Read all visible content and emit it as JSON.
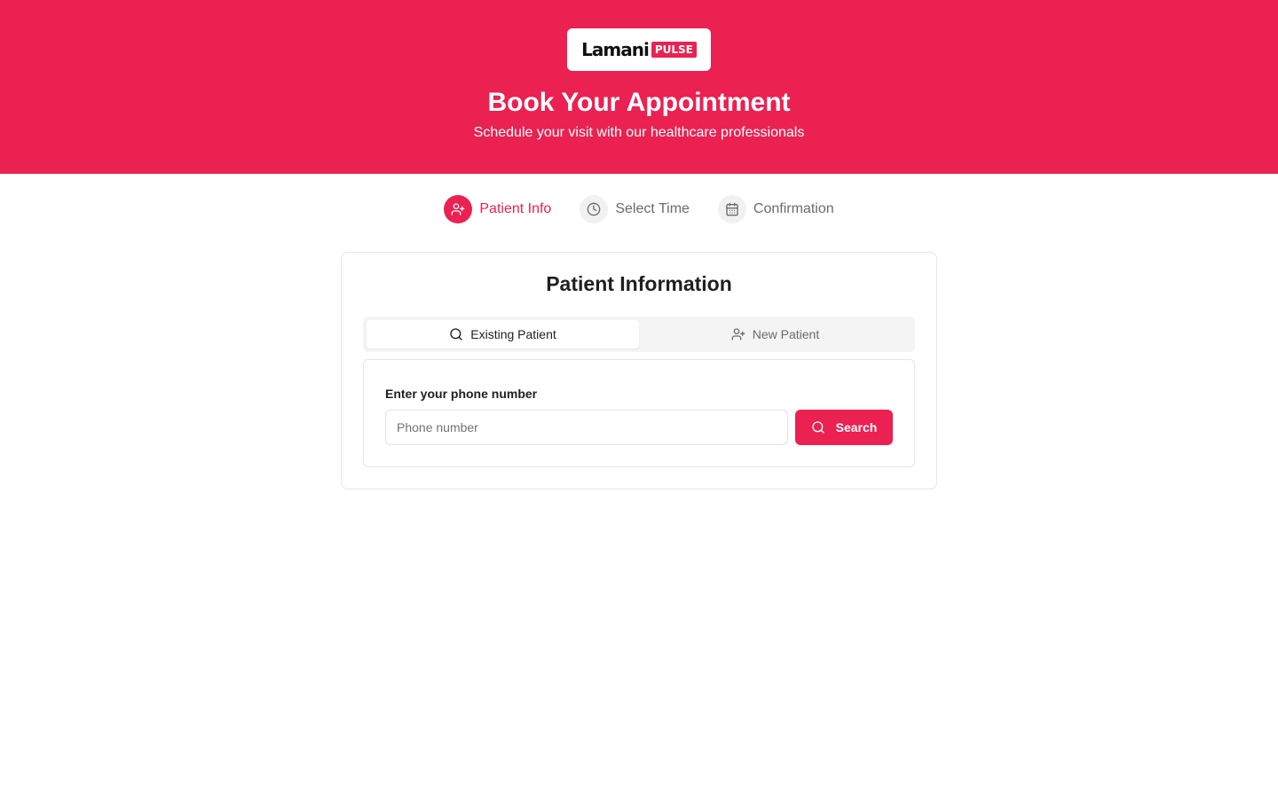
{
  "brand": {
    "logo_word": "Lamani",
    "logo_badge": "PULSE",
    "accent_color": "#eb2151"
  },
  "hero": {
    "title": "Book Your Appointment",
    "subtitle": "Schedule your visit with our healthcare professionals"
  },
  "steps": [
    {
      "label": "Patient Info",
      "icon": "user-plus-icon",
      "active": true
    },
    {
      "label": "Select Time",
      "icon": "clock-icon",
      "active": false
    },
    {
      "label": "Confirmation",
      "icon": "calendar-icon",
      "active": false
    }
  ],
  "card": {
    "title": "Patient Information",
    "tabs": [
      {
        "label": "Existing Patient",
        "icon": "search-icon",
        "active": true
      },
      {
        "label": "New Patient",
        "icon": "user-plus-icon",
        "active": false
      }
    ],
    "form": {
      "label": "Enter your phone number",
      "phone_value": "",
      "phone_placeholder": "Phone number",
      "search_label": "Search"
    }
  }
}
